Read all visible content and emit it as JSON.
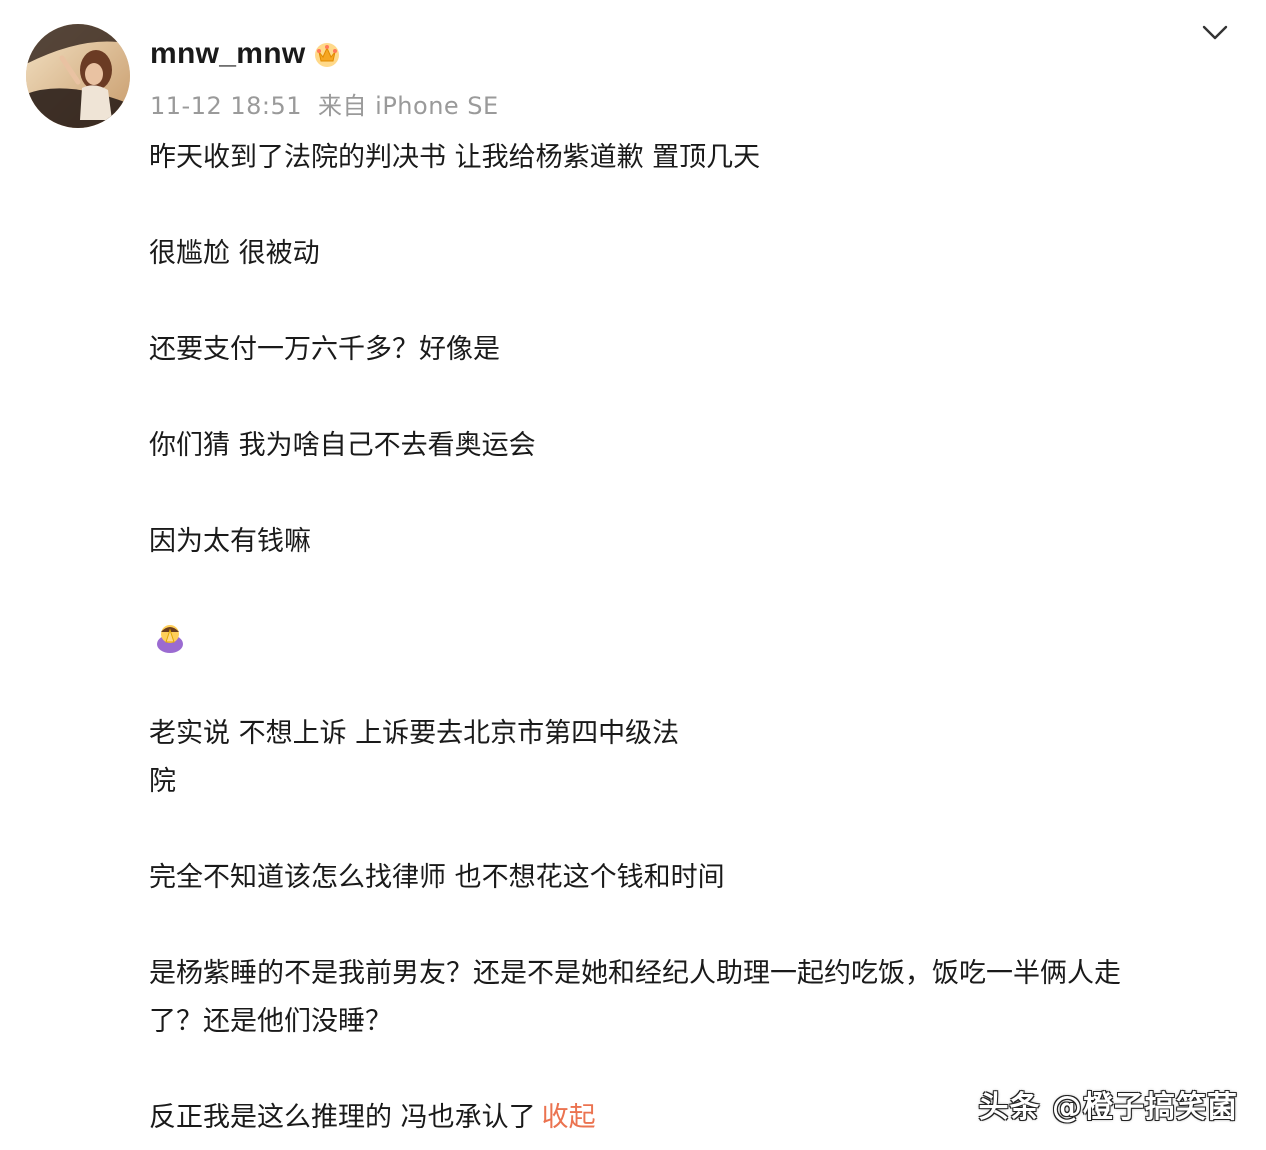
{
  "post": {
    "username": "mnw_mnw",
    "badge_icon": "vip-crown-icon",
    "timestamp": "11-12 18:51",
    "source": "来自 iPhone SE",
    "expand_icon": "chevron-down-icon",
    "lines": [
      "昨天收到了法院的判决书 让我给杨紫道歉 置顶几天",
      "很尴尬 很被动",
      "还要支付一万六千多？好像是",
      "你们猜 我为啥自己不去看奥运会",
      "因为太有钱嘛",
      "老实说 不想上诉 上诉要去北京市第四中级法",
      "院",
      "完全不知道该怎么找律师 也不想花这个钱和时间",
      "是杨紫睡的不是我前男友？还是不是她和经纪人助理一起约吃饭，饭吃一半俩人走",
      "了？还是他们没睡？",
      "反正我是这么推理的 冯也承认了"
    ],
    "emoji": "praying-emoji-icon",
    "collapse_label": "收起",
    "link_color": "#eb7350"
  },
  "watermark": "头条 @橙子搞笑菌"
}
